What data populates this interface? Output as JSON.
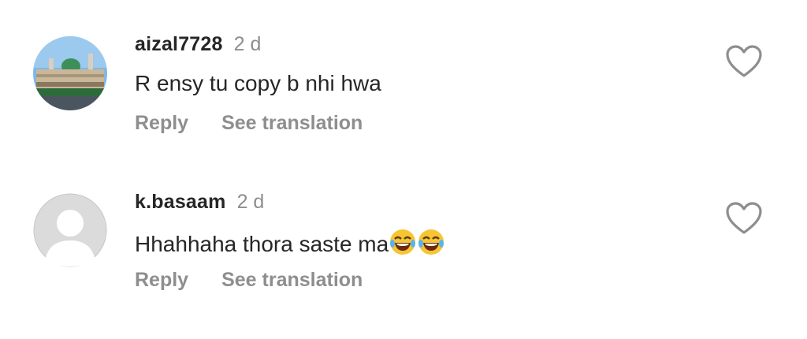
{
  "comments": [
    {
      "username": "aizal7728",
      "time": "2 d",
      "text": "R ensy tu copy b nhi hwa",
      "reply_label": "Reply",
      "translate_label": "See translation",
      "avatar": "mosque-photo-avatar"
    },
    {
      "username": "k.basaam",
      "time": "2 d",
      "text": "Hhahhaha thora saste ma",
      "emoji": "😂😂",
      "reply_label": "Reply",
      "translate_label": "See translation",
      "avatar": "default-avatar"
    }
  ],
  "colors": {
    "primary_text": "#262626",
    "secondary_text": "#8e8e8e",
    "heart_outline": "#8e8e8e"
  }
}
